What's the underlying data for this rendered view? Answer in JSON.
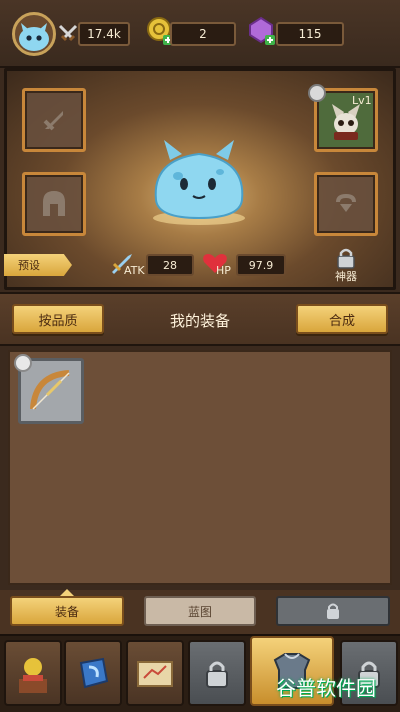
{
  "resources": {
    "power": "17.4k",
    "gold": "2",
    "gems": "115"
  },
  "hero": {
    "level": "Lv1",
    "preset_label": "预设",
    "atk_label": "ATK",
    "atk_value": "28",
    "hp_label": "HP",
    "hp_value": "97.9",
    "artifact_label": "神器"
  },
  "panel": {
    "sort_button": "按品质",
    "title": "我的装备",
    "craft_button": "合成"
  },
  "tabs": {
    "equipment": "装备",
    "blueprint": "蓝图"
  },
  "watermark": "谷普软件园",
  "colors": {
    "accent_gold": "#e3b552",
    "panel_brown": "#6d4f38",
    "slime_blue": "#8fd7f0"
  }
}
